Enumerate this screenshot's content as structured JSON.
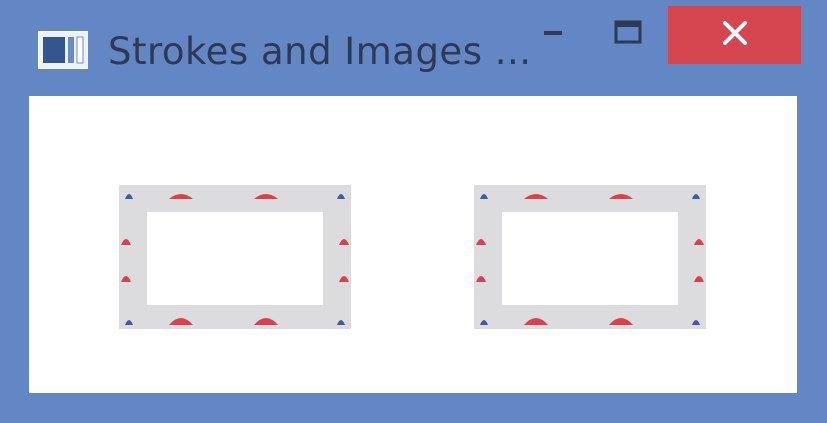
{
  "window": {
    "title": "Strokes and Images ...",
    "icons": {
      "app": "app-window-icon",
      "minimize": "minimize-icon",
      "maximize": "maximize-icon",
      "close": "close-icon"
    },
    "colors": {
      "frame": "#6386c4",
      "title_text": "#2e3a55",
      "close_button": "#d64650",
      "client_background": "#ffffff"
    }
  },
  "content": {
    "shapes": [
      {
        "name": "image-stroke-rectangle-1",
        "stroke_color": "#dcdcdf",
        "marker_corner_color": "#3f5ba6",
        "marker_color": "#d9414c"
      },
      {
        "name": "image-stroke-rectangle-2",
        "stroke_color": "#dcdcdf",
        "marker_corner_color": "#3f5ba6",
        "marker_color": "#d9414c"
      }
    ]
  }
}
